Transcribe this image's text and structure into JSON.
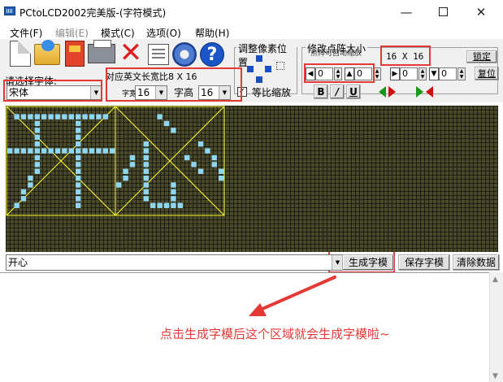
{
  "window": {
    "title": "PCtoLCD2002完美版-(字符模式)",
    "controls": [
      "—",
      "✕"
    ]
  },
  "menu": {
    "items": [
      "文件(F)",
      "编辑(E)",
      "模式(C)",
      "选项(O)",
      "帮助(H)"
    ]
  },
  "toolbar": {
    "icons": [
      "new-file-icon",
      "open-folder-icon",
      "save-icon",
      "print-icon",
      "delete-icon",
      "list-icon",
      "settings-gear-icon",
      "help-icon"
    ],
    "help_glyph": "?",
    "delete_glyph": "✕"
  },
  "pixel_group": {
    "title": "调整像素位置"
  },
  "matrix_group": {
    "title": "修改点阵大小",
    "sublabel": "点阵可自动缩放",
    "size_readout": "16 X 16",
    "spinners": [
      "0",
      "0",
      "0",
      "0"
    ],
    "lock_label": "锁定",
    "restore_label": "复位"
  },
  "font": {
    "label": "请选择字体:",
    "selected": "宋体",
    "ratio_label": "对应英文长宽比8 X 16",
    "width_label": "字宽",
    "width_value": "16",
    "height_label": "字高",
    "height_value": "16",
    "scale_checked": "✓",
    "scale_label": "等比缩放",
    "format_buttons": [
      "B",
      "/",
      "U"
    ]
  },
  "canvas": {
    "characters": [
      "开",
      "心"
    ],
    "grid_color": "#4a4a2a",
    "pixel_color": "#8fd6f0",
    "guide_color": "#ffff30"
  },
  "input": {
    "value": "开心"
  },
  "buttons": {
    "generate": "生成字模",
    "save_font": "保存字模",
    "clear": "清除数据"
  },
  "annotation": {
    "text": "点击生成字模后这个区域就会生成字模啦~",
    "color": "#e53935"
  },
  "colors": {
    "highlight": "#e53935"
  }
}
